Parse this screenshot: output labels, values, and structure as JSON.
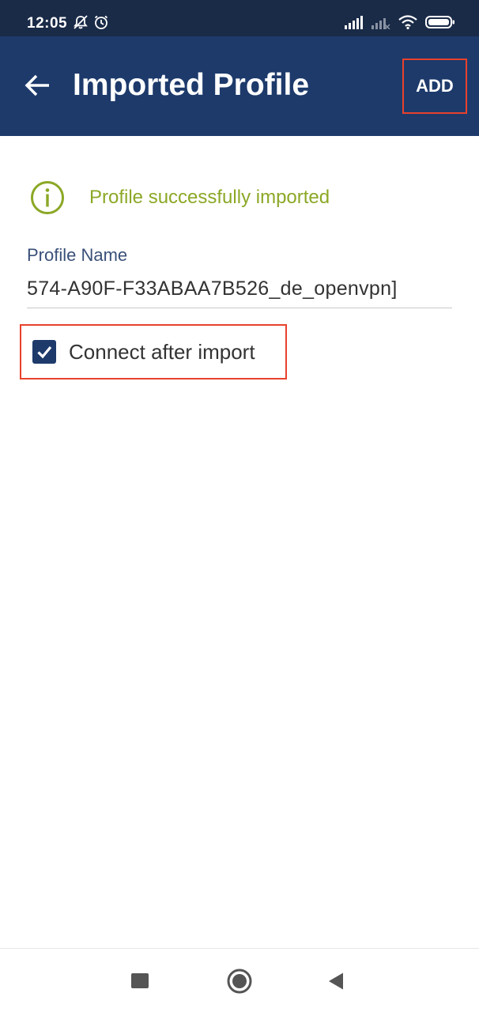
{
  "status_bar": {
    "time": "12:05",
    "icons": [
      "notifications-off-icon",
      "alarm-icon",
      "signal-icon",
      "signal-weak-icon",
      "wifi-icon",
      "battery-icon"
    ]
  },
  "app_bar": {
    "title": "Imported Profile",
    "back_icon": "arrow-left-icon",
    "add_label": "ADD"
  },
  "main": {
    "success_message": "Profile successfully imported",
    "success_icon": "info-icon",
    "profile_name_label": "Profile Name",
    "profile_name_value": "574-A90F-F33ABAA7B526_de_openvpn]",
    "connect_after_import_label": "Connect after import",
    "connect_after_import_checked": true
  },
  "nav_bar": {
    "icons": [
      "recents-square-icon",
      "home-circle-icon",
      "back-triangle-icon"
    ]
  },
  "colors": {
    "status_bar": "#1a2b48",
    "app_bar": "#1d3a6b",
    "success_green": "#8ba826",
    "label_blue": "#3a5079",
    "highlight_red": "#e8412c"
  }
}
